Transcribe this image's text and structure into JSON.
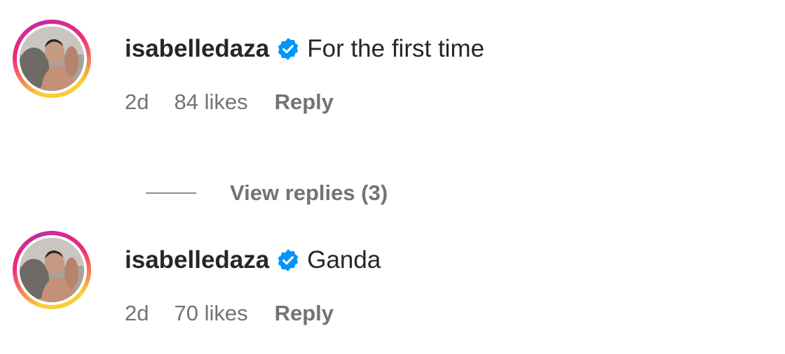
{
  "comments": [
    {
      "username": "isabelledaza",
      "verified": true,
      "text": "For the first time",
      "time": "2d",
      "likes": "84 likes",
      "reply_label": "Reply",
      "view_replies": "View replies (3)"
    },
    {
      "username": "isabelledaza",
      "verified": true,
      "text": "Ganda",
      "time": "2d",
      "likes": "70 likes",
      "reply_label": "Reply"
    }
  ],
  "colors": {
    "verified_badge": "#0095f6",
    "secondary_text": "#737373",
    "primary_text": "#262626"
  }
}
